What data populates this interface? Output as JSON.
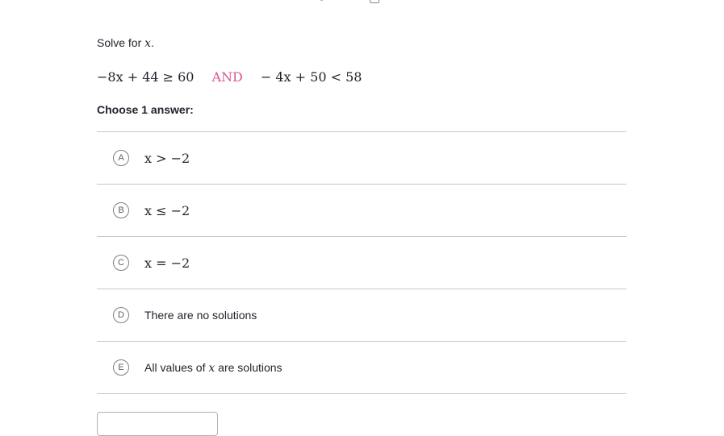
{
  "question": {
    "prompt_prefix": "Solve for ",
    "prompt_var": "x",
    "prompt_suffix": "."
  },
  "equation": {
    "left": "−8x + 44 ≥ 60",
    "connector": "AND",
    "right": "− 4x + 50 < 58"
  },
  "choose_label": "Choose 1 answer:",
  "choices": [
    {
      "letter": "A",
      "text": "x > −2"
    },
    {
      "letter": "B",
      "text": "x ≤ −2"
    },
    {
      "letter": "C",
      "text": "x = −2"
    },
    {
      "letter": "D",
      "text": "There are no solutions"
    },
    {
      "letter": "E",
      "text_prefix": "All values of ",
      "text_var": "x",
      "text_suffix": " are solutions"
    }
  ],
  "colors": {
    "accent_and": "#d9579a",
    "divider": "#c4c6ca"
  }
}
